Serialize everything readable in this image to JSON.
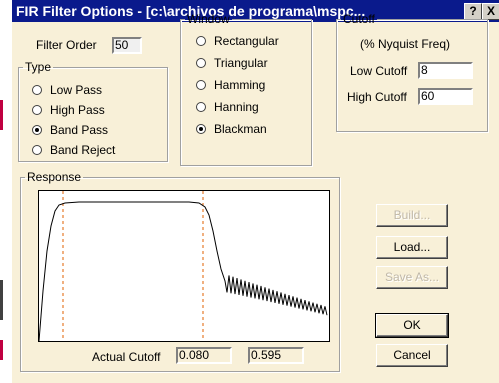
{
  "title": "FIR Filter Options - [c:\\archivos de programa\\mspc...",
  "titlebar_buttons": {
    "help": "?",
    "close": "X"
  },
  "filter_order": {
    "label": "Filter Order",
    "value": "50"
  },
  "type": {
    "legend": "Type",
    "options": [
      "Low Pass",
      "High Pass",
      "Band Pass",
      "Band Reject"
    ],
    "selected": "Band Pass"
  },
  "window": {
    "legend": "Window",
    "options": [
      "Rectangular",
      "Triangular",
      "Hamming",
      "Hanning",
      "Blackman"
    ],
    "selected": "Blackman"
  },
  "cutoff": {
    "legend": "Cutoff",
    "subtitle": "(% Nyquist Freq)",
    "low_label": "Low Cutoff",
    "low_value": "8",
    "high_label": "High Cutoff",
    "high_value": "60"
  },
  "response": {
    "legend": "Response",
    "actual_cutoff_label": "Actual Cutoff",
    "actual_low": "0.080",
    "actual_high": "0.595"
  },
  "buttons": {
    "build": "Build...",
    "load": "Load...",
    "save_as": "Save As...",
    "ok": "OK",
    "cancel": "Cancel"
  },
  "colors": {
    "titlebar": "#0a1a8c",
    "dialog_bg": "#f8f0d8",
    "cutoff_lines": "#e06000"
  }
}
